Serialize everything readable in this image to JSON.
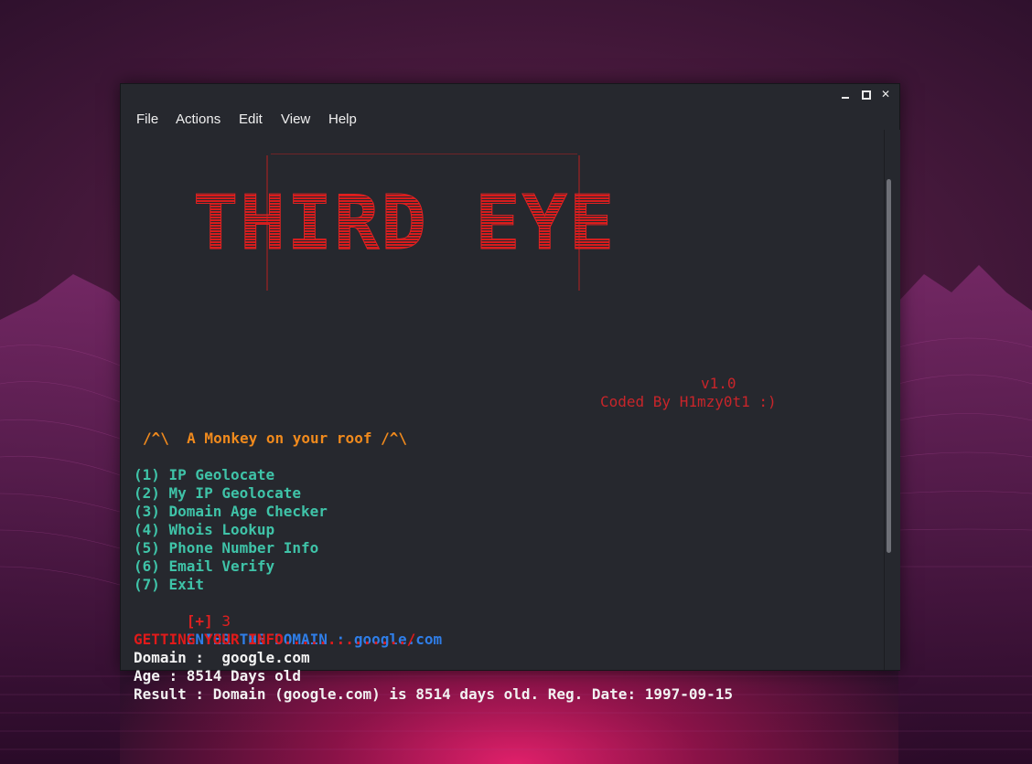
{
  "window": {
    "controls": {
      "minimize": "minimize",
      "maximize": "maximize",
      "close": "✕"
    }
  },
  "menubar": {
    "items": [
      "File",
      "Actions",
      "Edit",
      "View",
      "Help"
    ]
  },
  "terminal": {
    "logo_text": "THIRD EYE",
    "version": "v1.0",
    "coded_by": "Coded By H1mzy0t1 :)",
    "tagline": "/^\\  A Monkey on your roof /^\\",
    "menu_options": [
      "(1) IP Geolocate",
      "(2) My IP Geolocate",
      "(3) Domain Age Checker",
      "(4) Whois Lookup",
      "(5) Phone Number Info",
      "(6) Email Verify",
      "(7) Exit"
    ],
    "prompt_symbol": "[+]",
    "prompt_value": "3",
    "enter_domain_label": "ENTER THE DOMAIN :",
    "enter_domain_value": "google.com",
    "getting_info": "GETTING YOUR INFO............../",
    "output": {
      "domain": "Domain :  google.com",
      "age": "Age : 8514 Days old",
      "result": "Result : Domain (google.com) is 8514 days old. Reg. Date: 1997-09-15"
    }
  },
  "colors": {
    "logo_red": "#d91c1c",
    "menu_teal": "#3fc3a8",
    "tagline_orange": "#f08a1d",
    "enter_blue": "#2f7ee8",
    "terminal_bg": "#26282e"
  }
}
